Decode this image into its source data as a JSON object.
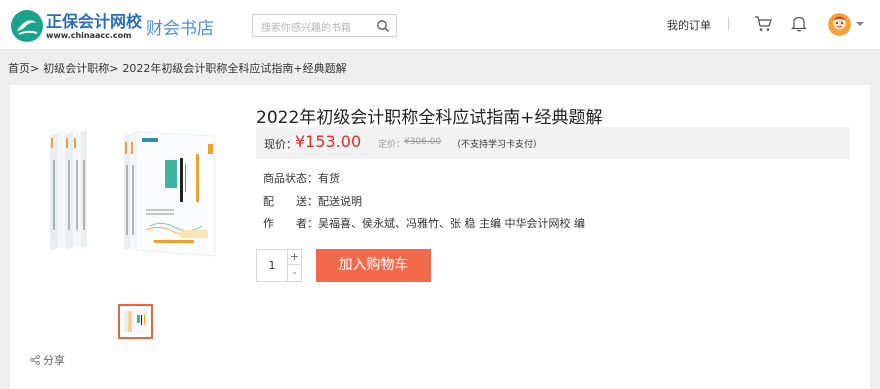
{
  "header": {
    "logo_title": "正保会计网校",
    "logo_url": "www.chinaacc.com",
    "store_name": "财会书店",
    "search_placeholder": "搜索你感兴趣的书籍",
    "orders_link": "我的订单",
    "icons": [
      "logo-icon",
      "search-icon",
      "cart-icon",
      "bell-icon",
      "avatar",
      "chevron-down-icon"
    ]
  },
  "breadcrumb": [
    "首页>",
    "初级会计职称>",
    "2022年初级会计职称全科应试指南+经典题解"
  ],
  "product": {
    "title": "2022年初级会计职称全科应试指南+经典题解",
    "price_label": "现价：",
    "price": "¥153.00",
    "original_label": "定价：",
    "original_price": "¥306.00",
    "original_note": "（不支持学习卡支付）",
    "status_label": "商品状态：",
    "status_value": "有货",
    "delivery_label": "配　　送：",
    "delivery_value": "配送说明",
    "author_label": "作　　者：",
    "author_value": "吴福喜、侯永斌、冯雅竹、张 稳 主编 中华会计网校 编",
    "quantity": "1",
    "qty_inc": "+",
    "qty_dec": "-",
    "add_to_cart": "加入购物车",
    "share": "分享"
  },
  "colors": {
    "brand_blue": "#1f66c2",
    "price_red": "#e02b2b",
    "cart_button": "#f26a4b",
    "thumb_border": "#e8663f"
  }
}
